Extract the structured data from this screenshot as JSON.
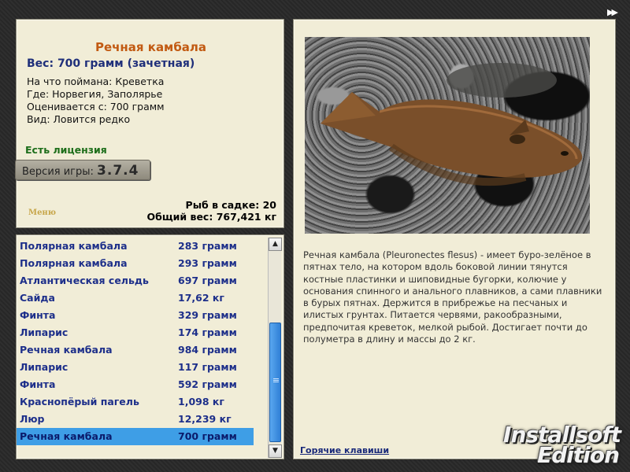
{
  "info": {
    "title": "Речная камбала",
    "weight": "Вес: 700 грамм (зачетная)",
    "caught_on": "На что поймана: Креветка",
    "where": "Где: Норвегия, Заполярье",
    "rated": "Оценивается с: 700 грамм",
    "kind": "Вид: Ловится редко",
    "license": "Есть лицензия",
    "version_label": "Версия игры:",
    "version_value": "3.7.4",
    "menu": "Меню",
    "fish_count": "Рыб в садке: 20",
    "total_weight": "Общий вес: 767,421 кг"
  },
  "catch_list": [
    {
      "name": "Полярная камбала",
      "weight": "283 грамм"
    },
    {
      "name": "Полярная камбала",
      "weight": "293 грамм"
    },
    {
      "name": "Атлантическая сельдь",
      "weight": "697 грамм"
    },
    {
      "name": "Сайда",
      "weight": "17,62 кг"
    },
    {
      "name": "Финта",
      "weight": "329 грамм"
    },
    {
      "name": "Липарис",
      "weight": "174 грамм"
    },
    {
      "name": "Речная камбала",
      "weight": "984 грамм"
    },
    {
      "name": "Липарис",
      "weight": "117 грамм"
    },
    {
      "name": "Финта",
      "weight": "592 грамм"
    },
    {
      "name": "Краснопёрый пагель",
      "weight": "1,098 кг"
    },
    {
      "name": "Люр",
      "weight": "12,239 кг"
    },
    {
      "name": "Речная камбала",
      "weight": "700 грамм",
      "selected": true
    }
  ],
  "description": "Речная камбала (Pleuronectes flesus) - имеет буро-зелёное в пятнах тело, на котором вдоль боковой линии тянутся костные пластинки и шиповидные бугорки, колючие у основания спинного и анального плавников, а сами плавники в бурых пятнах. Держится в прибрежье на песчаных и илистых грунтах. Питается червями, ракообразными, предпочитая креветок, мелкой рыбой. Достигает почти до полуметра в длину и массы до 2 кг.",
  "hotkeys": "Горячие клавиши",
  "brand": {
    "line1": "Installsoft",
    "line2": "Edition"
  },
  "icons": {
    "fast_forward": "fast-forward-icon",
    "scroll_up": "arrow-up-icon",
    "scroll_down": "arrow-down-icon"
  },
  "colors": {
    "title": "#c25a12",
    "list_text": "#1d2f8a",
    "selection": "#3e9ee6",
    "license": "#1d6e1a"
  }
}
